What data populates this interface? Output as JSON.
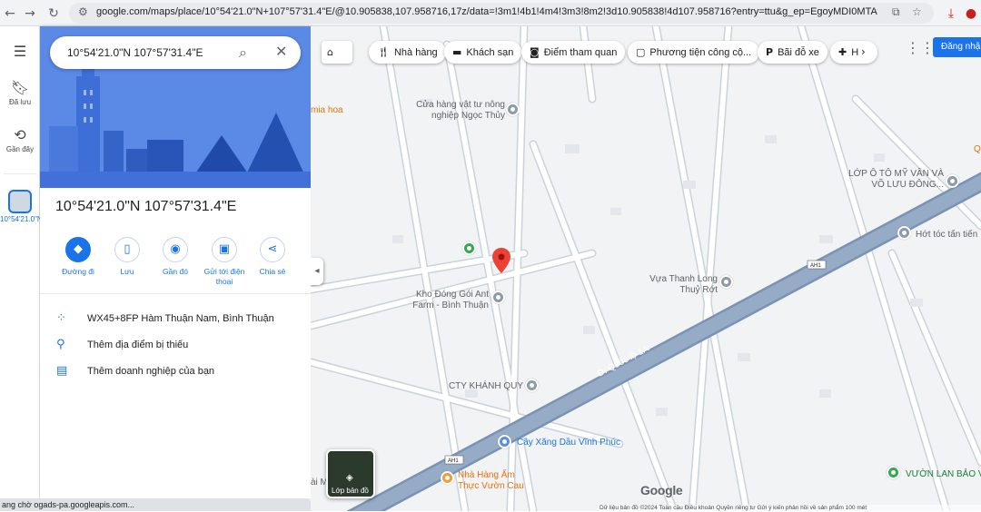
{
  "browser": {
    "url": "google.com/maps/place/10°54'21.0\"N+107°57'31.4\"E/@10.905838,107.958716,17z/data=!3m1!4b1!4m4!3m3!8m2!3d10.905838!4d107.958716?entry=ttu&g_ep=EgoyMDI0MTAyMy4wIKXM...",
    "status_text": "ang chờ ogads-pa.googleapis.com..."
  },
  "rail": {
    "saved_label": "Đã lưu",
    "recent_label": "Gần đây",
    "current_label": "10°54'21.0\"N..."
  },
  "search": {
    "query": "10°54'21.0\"N 107°57'31.4\"E"
  },
  "place": {
    "title": "10°54'21.0\"N 107°57'31.4\"E",
    "actions": [
      {
        "label": "Đường đi"
      },
      {
        "label": "Lưu"
      },
      {
        "label": "Gần đó"
      },
      {
        "label": "Gửi tới điện thoại"
      },
      {
        "label": "Chia sẻ"
      }
    ],
    "plus_code": "WX45+8FP Hàm Thuận Nam, Bình Thuận",
    "add_missing_place": "Thêm địa điểm bị thiếu",
    "add_business": "Thêm doanh nghiệp của bạn"
  },
  "map": {
    "categories": [
      {
        "label": "Nhà hàng",
        "icon": "restaurant-icon"
      },
      {
        "label": "Khách sạn",
        "icon": "hotel-icon"
      },
      {
        "label": "Điểm tham quan",
        "icon": "camera-icon"
      },
      {
        "label": "Phương tiện công cộ...",
        "icon": "transit-icon"
      },
      {
        "label": "Bãi đỗ xe",
        "icon": "parking-icon"
      },
      {
        "label": "H",
        "icon": "pharmacy-icon"
      }
    ],
    "sign_in": "Đăng nhập",
    "pois": [
      {
        "name": "Cửa hàng vật tư nông nghiệp Ngọc Thủy"
      },
      {
        "name": "LỚP Ô TÔ MỸ VÂN VÀ VÕ LƯU ĐÔNG..."
      },
      {
        "name": "Hớt tóc tấn tiến"
      },
      {
        "name": "Vựa Thanh Long Thuỷ Rớt"
      },
      {
        "name": "Kho Đóng Gói Ant Farm - Bình Thuận"
      },
      {
        "name": "CTY KHÁNH QUY"
      },
      {
        "name": "Cây Xăng Dầu Vĩnh Phúc"
      },
      {
        "name": "Nhà Hàng Ẩm Thực Vườn Cau"
      },
      {
        "name": "VƯỜN LAN BẢO V"
      }
    ],
    "road_name": "Đ. Quốc lộ 1A",
    "highway_badge": "AH1",
    "partial_labels": [
      "mia hoa",
      "Q",
      "ài M"
    ],
    "layers_label": "Lớp bản đồ",
    "google_logo": "Google",
    "attribution": "Dữ liệu bản đồ ©2024   Toàn cầu   Điều khoản   Quyền riêng tư   Gửi ý kiến phản hồi về sản phẩm   100 mét"
  }
}
